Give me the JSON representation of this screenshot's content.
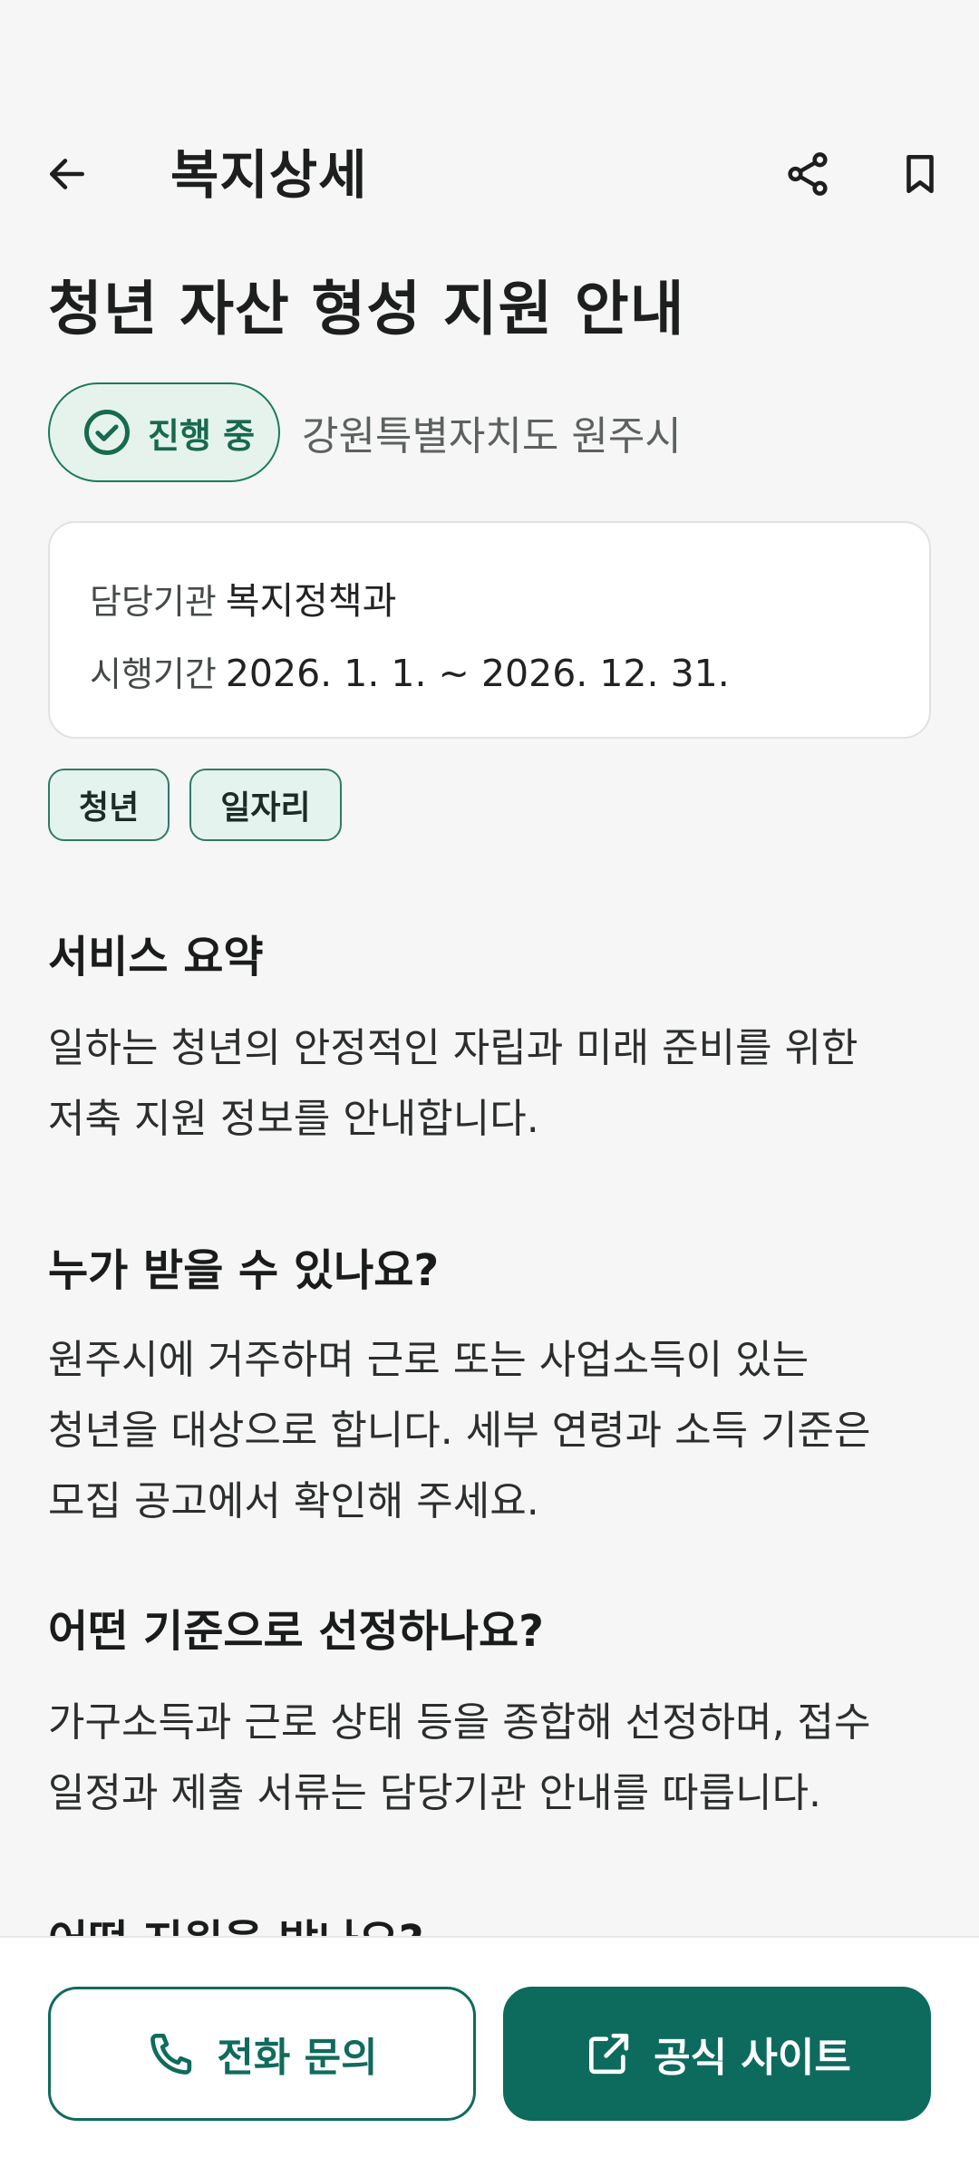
{
  "header": {
    "title": "복지상세",
    "back_icon": "arrow-left",
    "share_icon": "share",
    "bookmark_icon": "bookmark"
  },
  "service": {
    "title": "청년 자산 형성 지원 안내",
    "status": "진행 중",
    "region": "강원특별자치도 원주시"
  },
  "info": {
    "agency_label": "담당기관",
    "agency_value": "복지정책과",
    "period_label": "시행기간",
    "period_value": "2026. 1. 1. ~ 2026. 12. 31."
  },
  "tags": [
    "청년",
    "일자리"
  ],
  "sections": [
    {
      "heading": "서비스 요약",
      "body": "일하는 청년의 안정적인 자립과 미래 준비를 위한 저축 지원 정보를 안내합니다."
    },
    {
      "heading": "누가 받을 수 있나요?",
      "body": "원주시에 거주하며 근로 또는 사업소득이 있는 청년을 대상으로 합니다. 세부 연령과 소득 기준은 모집 공고에서 확인해 주세요."
    },
    {
      "heading": "어떤 기준으로 선정하나요?",
      "body": "가구소득과 근로 상태 등을 종합해 선정하며, 접수 일정과 제출 서류는 담당기관 안내를 따릅니다."
    },
    {
      "heading": "어떤 지원을 받나요?"
    }
  ],
  "actions": {
    "phone_label": "전화 문의",
    "site_label": "공식 사이트"
  },
  "colors": {
    "accent": "#0d6b5e",
    "status_bg": "#e5f3ec",
    "background": "#f5f6f5"
  }
}
